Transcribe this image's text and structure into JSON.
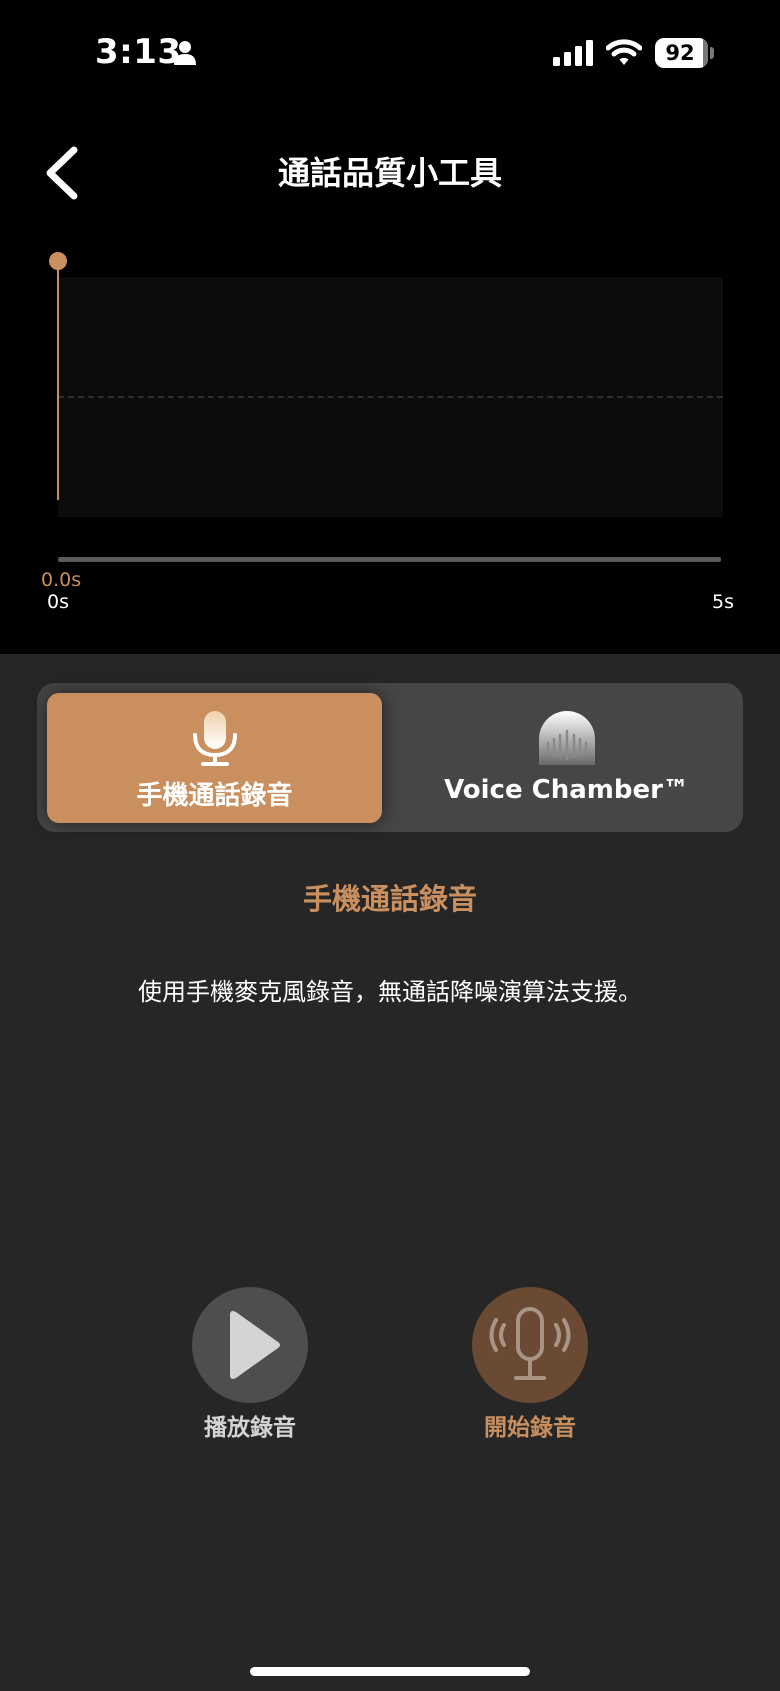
{
  "status_bar": {
    "time": "3:13",
    "battery_level": "92",
    "icons": [
      "person-icon",
      "cellular-signal-icon",
      "wifi-icon",
      "battery-icon"
    ]
  },
  "header": {
    "title": "通話品質小工具",
    "back_icon": "chevron-left-icon"
  },
  "waveform": {
    "current_time": "0.0s",
    "start_label": "0s",
    "end_label": "5s",
    "playhead_progress": 0
  },
  "mode_selector": {
    "options": [
      {
        "label": "手機通話錄音",
        "icon": "microphone-icon",
        "selected": true
      },
      {
        "label": "Voice Chamber™",
        "icon": "voice-chamber-icon",
        "selected": false
      }
    ]
  },
  "mode_info": {
    "heading": "手機通話錄音",
    "description": "使用手機麥克風錄音，無通話降噪演算法支援。"
  },
  "controls": {
    "play_label": "播放錄音",
    "record_label": "開始錄音"
  },
  "colors": {
    "accent": "#c98f5e",
    "background_top": "#000000",
    "background_bottom": "#262626",
    "selector_bg": "#464646",
    "record_button_bg": "#6b4a34",
    "play_button_bg": "#4e4e4e"
  }
}
